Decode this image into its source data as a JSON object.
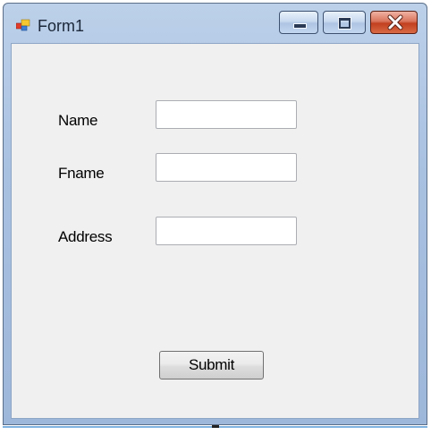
{
  "window": {
    "title": "Form1",
    "icon": "windows-forms-app-icon"
  },
  "titlebar_buttons": {
    "minimize_icon": "minimize-icon",
    "maximize_icon": "maximize-icon",
    "close_icon": "close-icon"
  },
  "form": {
    "name_label": "Name",
    "name_value": "",
    "fname_label": "Fname",
    "fname_value": "",
    "address_label": "Address",
    "address_value": "",
    "submit_label": "Submit"
  },
  "colors": {
    "titlebar": "#a9c1e1",
    "client_background": "#f0f0f0",
    "close_button": "#c2401f"
  }
}
